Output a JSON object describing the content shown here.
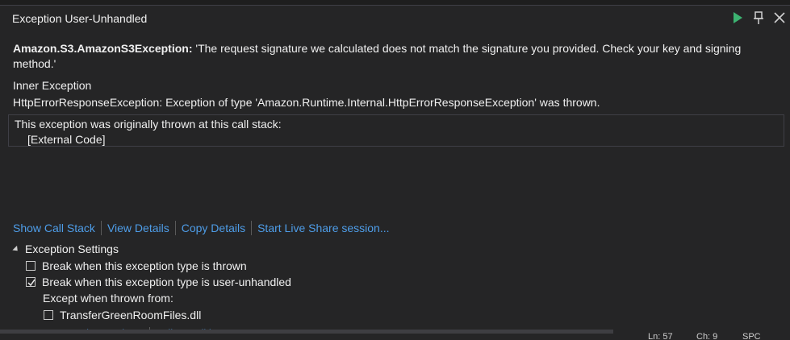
{
  "window": {
    "title": "Exception User-Unhandled"
  },
  "exception": {
    "type": "Amazon.S3.AmazonS3Exception:",
    "message": " 'The request signature we calculated does not match the signature you provided. Check your key and signing method.'",
    "inner_heading": "Inner Exception",
    "inner_text": "HttpErrorResponseException: Exception of type 'Amazon.Runtime.Internal.HttpErrorResponseException' was thrown."
  },
  "callstack": {
    "heading": "This exception was originally thrown at this call stack:",
    "frames": [
      "[External Code]"
    ]
  },
  "links": {
    "show_call_stack": "Show Call Stack",
    "view_details": "View Details",
    "copy_details": "Copy Details",
    "live_share": "Start Live Share session..."
  },
  "settings": {
    "heading": "Exception Settings",
    "break_thrown": {
      "label": "Break when this exception type is thrown",
      "checked": false
    },
    "break_unhandled": {
      "label": "Break when this exception type is user-unhandled",
      "checked": true
    },
    "except_label": "Except when thrown from:",
    "module": {
      "label": "TransferGreenRoomFiles.dll",
      "checked": false
    }
  },
  "footer_links": {
    "open_settings": "Open Exception Settings",
    "edit_conditions": "Edit Conditions"
  },
  "statusbar": {
    "line": "Ln: 57",
    "col": "Ch: 9",
    "mode": "SPC"
  },
  "colors": {
    "accent_link": "#4e9de8",
    "continue_green": "#3cb371",
    "background": "#252526"
  }
}
